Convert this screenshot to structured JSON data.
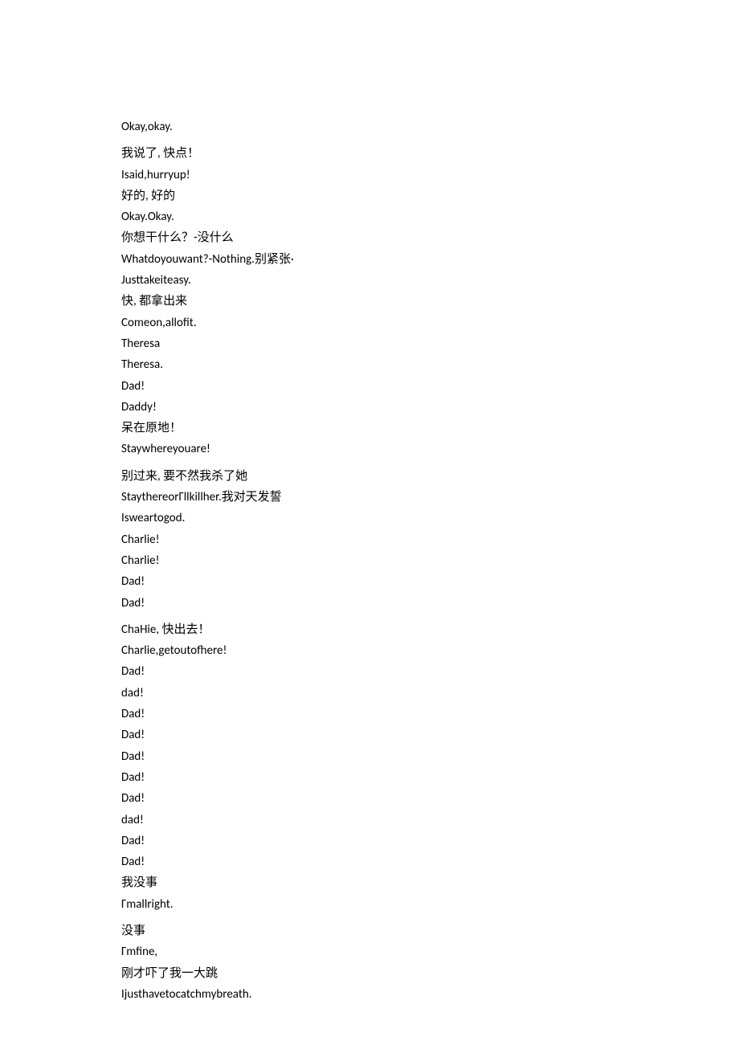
{
  "lines": [
    {
      "text": "Okay,okay.",
      "gapAfter": true
    },
    {
      "text": "我说了, 快点！"
    },
    {
      "text": "Isaid,hurryup!"
    },
    {
      "text": "好的, 好的"
    },
    {
      "text": "Okay.Okay."
    },
    {
      "text": "你想干什么？-没什么"
    },
    {
      "text": "Whatdoyouwant?-Nothing.别紧张·"
    },
    {
      "text": "Justtakeiteasy."
    },
    {
      "text": "快, 都拿出来"
    },
    {
      "text": "Comeon,allofit."
    },
    {
      "text": "Theresa"
    },
    {
      "text": "Theresa."
    },
    {
      "text": "Dad!"
    },
    {
      "text": "Daddy!"
    },
    {
      "text": "呆在原地！"
    },
    {
      "text": "Staywhereyouare!",
      "gapAfter": true
    },
    {
      "text": "别过来, 要不然我杀了她"
    },
    {
      "text": "StaythereorΓllkillher.我对天发誓"
    },
    {
      "text": "Isweartogod."
    },
    {
      "text": "Charlie!"
    },
    {
      "text": "Charlie!"
    },
    {
      "text": "Dad!"
    },
    {
      "text": "Dad!",
      "gapAfter": true
    },
    {
      "text": "ChaHie, 快出去！"
    },
    {
      "text": "Charlie,getoutofhere!"
    },
    {
      "text": "Dad!"
    },
    {
      "text": "dad!"
    },
    {
      "text": "Dad!"
    },
    {
      "text": "Dad!"
    },
    {
      "text": "Dad!"
    },
    {
      "text": "Dad!"
    },
    {
      "text": "Dad!"
    },
    {
      "text": "dad!"
    },
    {
      "text": "Dad!"
    },
    {
      "text": "Dad!"
    },
    {
      "text": "我没事"
    },
    {
      "text": "Γmallright.",
      "gapAfter": true
    },
    {
      "text": "没事"
    },
    {
      "text": "Γmfine,"
    },
    {
      "text": "刚才吓了我一大跳"
    },
    {
      "text": "Ijusthavetocatchmybreath."
    }
  ]
}
